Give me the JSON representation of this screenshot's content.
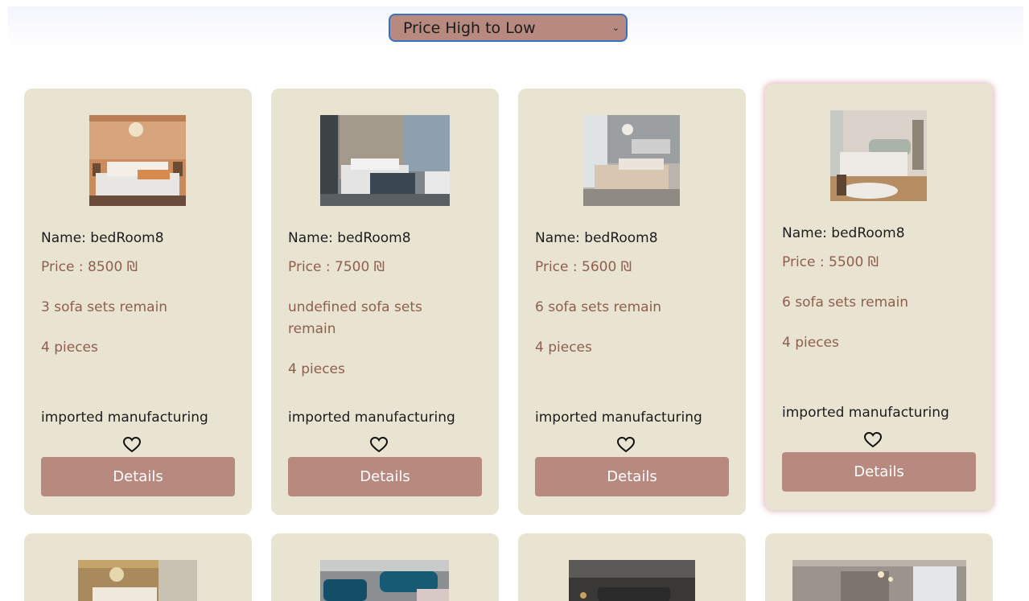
{
  "sort": {
    "selected": "Price High to Low"
  },
  "currency": "₪",
  "products": [
    {
      "name_line": "Name: bedRoom8",
      "price_line": "Price : 8500 ₪",
      "stock_line": "3 sofa sets remain",
      "pieces_line": "4 pieces",
      "manufacturing": "imported manufacturing",
      "details_label": "Details"
    },
    {
      "name_line": "Name: bedRoom8",
      "price_line": "Price : 7500 ₪",
      "stock_line": "undefined sofa sets remain",
      "pieces_line": "4 pieces",
      "manufacturing": "imported manufacturing",
      "details_label": "Details"
    },
    {
      "name_line": "Name: bedRoom8",
      "price_line": "Price : 5600 ₪",
      "stock_line": "6 sofa sets remain",
      "pieces_line": "4 pieces",
      "manufacturing": "imported manufacturing",
      "details_label": "Details"
    },
    {
      "name_line": "Name: bedRoom8",
      "price_line": "Price : 5500 ₪",
      "stock_line": "6 sofa sets remain",
      "pieces_line": "4 pieces",
      "manufacturing": "imported manufacturing",
      "details_label": "Details"
    }
  ],
  "icons": {
    "favorite": "heart-outline-icon",
    "dropdown": "chevron-down-icon"
  },
  "colors": {
    "card_bg": "#e9e4d2",
    "accent": "#b8897e",
    "text_brown": "#8f5e4e"
  }
}
